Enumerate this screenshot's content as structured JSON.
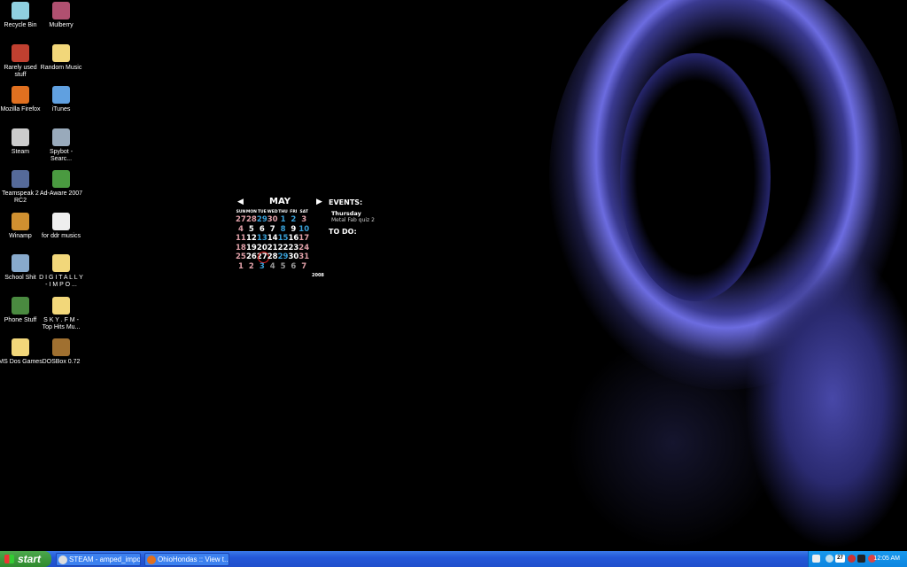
{
  "desktop_icons": [
    {
      "label": "Recycle Bin",
      "icon": "recycle-bin-icon"
    },
    {
      "label": "Mulberry",
      "icon": "mulberry-icon"
    },
    {
      "label": "Rarely used stuff",
      "icon": "archive-icon"
    },
    {
      "label": "Random Music",
      "icon": "folder-icon"
    },
    {
      "label": "Mozilla Firefox",
      "icon": "firefox-icon"
    },
    {
      "label": "iTunes",
      "icon": "itunes-icon"
    },
    {
      "label": "Steam",
      "icon": "steam-icon"
    },
    {
      "label": "Spybot - Searc...",
      "icon": "spybot-icon"
    },
    {
      "label": "Teamspeak 2 RC2",
      "icon": "teamspeak-icon"
    },
    {
      "label": "Ad-Aware 2007",
      "icon": "adaware-icon"
    },
    {
      "label": "Winamp",
      "icon": "winamp-icon"
    },
    {
      "label": "for ddr musics",
      "icon": "document-icon"
    },
    {
      "label": "School Shit",
      "icon": "school-icon"
    },
    {
      "label": "D I G I T A L L Y - I M P O ...",
      "icon": "folder-icon"
    },
    {
      "label": "Phone Stuff",
      "icon": "phone-icon"
    },
    {
      "label": "S K Y . F M - Top Hits Mu...",
      "icon": "folder-icon"
    },
    {
      "label": "MS Dos Games",
      "icon": "folder-icon"
    },
    {
      "label": "DOSBox 0.72",
      "icon": "dosbox-icon"
    }
  ],
  "calendar": {
    "month": "MAY",
    "year": "2008",
    "weekdays": [
      "SUN",
      "MON",
      "TUE",
      "WED",
      "THU",
      "FRI",
      "SAT"
    ],
    "weeks": [
      [
        [
          "27",
          "p"
        ],
        [
          "28",
          "p"
        ],
        [
          "29",
          "b"
        ],
        [
          "30",
          "p"
        ],
        [
          "1",
          "b"
        ],
        [
          "2",
          "b"
        ],
        [
          "3",
          "p"
        ]
      ],
      [
        [
          "4",
          "p"
        ],
        [
          "5",
          "w"
        ],
        [
          "6",
          "w"
        ],
        [
          "7",
          "w"
        ],
        [
          "8",
          "b"
        ],
        [
          "9",
          "w"
        ],
        [
          "10",
          "b"
        ]
      ],
      [
        [
          "11",
          "p"
        ],
        [
          "12",
          "w"
        ],
        [
          "13",
          "b"
        ],
        [
          "14",
          "w"
        ],
        [
          "15",
          "b"
        ],
        [
          "16",
          "w"
        ],
        [
          "17",
          "p"
        ]
      ],
      [
        [
          "18",
          "p"
        ],
        [
          "19",
          "w"
        ],
        [
          "20",
          "w"
        ],
        [
          "21",
          "w"
        ],
        [
          "22",
          "w"
        ],
        [
          "23",
          "w"
        ],
        [
          "24",
          "p"
        ]
      ],
      [
        [
          "25",
          "p"
        ],
        [
          "26",
          "w"
        ],
        [
          "27",
          "w today"
        ],
        [
          "28",
          "w"
        ],
        [
          "29",
          "b"
        ],
        [
          "30",
          "w"
        ],
        [
          "31",
          "p"
        ]
      ],
      [
        [
          "1",
          "p"
        ],
        [
          "2",
          "p"
        ],
        [
          "3",
          "b"
        ],
        [
          "4",
          "g"
        ],
        [
          "5",
          "g"
        ],
        [
          "6",
          "g"
        ],
        [
          "7",
          "p"
        ]
      ]
    ],
    "events_heading": "EVENTS:",
    "event_day": "Thursday",
    "event_item": "Metal Fab quiz 2",
    "todo_heading": "TO DO:"
  },
  "taskbar": {
    "start_label": "start",
    "tasks": [
      {
        "label": "STEAM - amped_imports"
      },
      {
        "label": "OhioHondas :: View t..."
      }
    ],
    "tray_date_badge": "27",
    "clock": "12:05 AM"
  }
}
